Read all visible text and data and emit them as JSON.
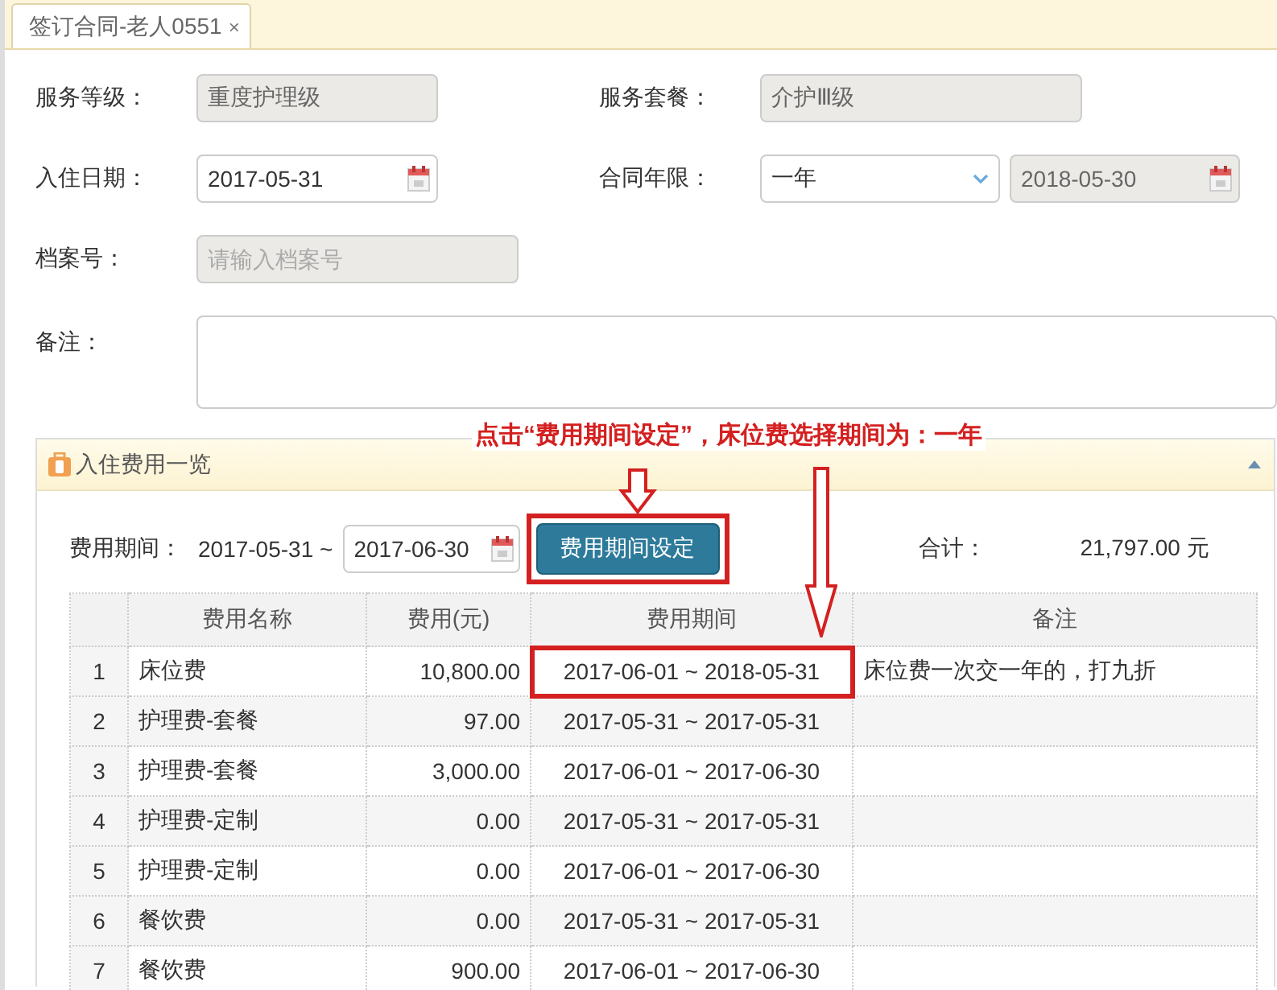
{
  "tab": {
    "label": "签订合同-老人0551",
    "close": "×",
    "selected": true
  },
  "form": {
    "service_level": {
      "label": "服务等级：",
      "value": "重度护理级"
    },
    "service_package": {
      "label": "服务套餐：",
      "value": "介护Ⅲ级"
    },
    "checkin_date": {
      "label": "入住日期：",
      "value": "2017-05-31"
    },
    "contract_term": {
      "label": "合同年限：",
      "value": "一年",
      "end_date": "2018-05-30"
    },
    "file_no": {
      "label": "档案号：",
      "placeholder": "请输入档案号"
    },
    "remarks": {
      "label": "备注："
    }
  },
  "annotation": {
    "text": "点击“费用期间设定”，床位费选择期间为：一年"
  },
  "fee_panel": {
    "title": "入住费用一览",
    "expanded": true,
    "period_label": "费用期间：",
    "period_start": "2017-05-31 ~",
    "period_end": "2017-06-30",
    "set_button": {
      "label": "费用期间设定",
      "highlighted": true
    },
    "total_label": "合计：",
    "total_value": "21,797.00 元",
    "columns": [
      "费用名称",
      "费用(元)",
      "费用期间",
      "备注"
    ],
    "rows": [
      {
        "index": "1",
        "name": "床位费",
        "fee": "10,800.00",
        "period": "2017-06-01 ~ 2018-05-31",
        "note": "床位费一次交一年的，打九折",
        "highlighted": true
      },
      {
        "index": "2",
        "name": "护理费-套餐",
        "fee": "97.00",
        "period": "2017-05-31 ~ 2017-05-31",
        "highlighted": false
      },
      {
        "index": "3",
        "name": "护理费-套餐",
        "fee": "3,000.00",
        "period": "2017-06-01 ~ 2017-06-30",
        "highlighted": false
      },
      {
        "index": "4",
        "name": "护理费-定制",
        "fee": "0.00",
        "period": "2017-05-31 ~ 2017-05-31",
        "highlighted": false
      },
      {
        "index": "5",
        "name": "护理费-定制",
        "fee": "0.00",
        "period": "2017-06-01 ~ 2017-06-30",
        "highlighted": false
      },
      {
        "index": "6",
        "name": "餐饮费",
        "fee": "0.00",
        "period": "2017-05-31 ~ 2017-05-31",
        "highlighted": false
      },
      {
        "index": "7",
        "name": "餐饮费",
        "fee": "900.00",
        "period": "2017-06-01 ~ 2017-06-30",
        "highlighted": false
      }
    ]
  }
}
